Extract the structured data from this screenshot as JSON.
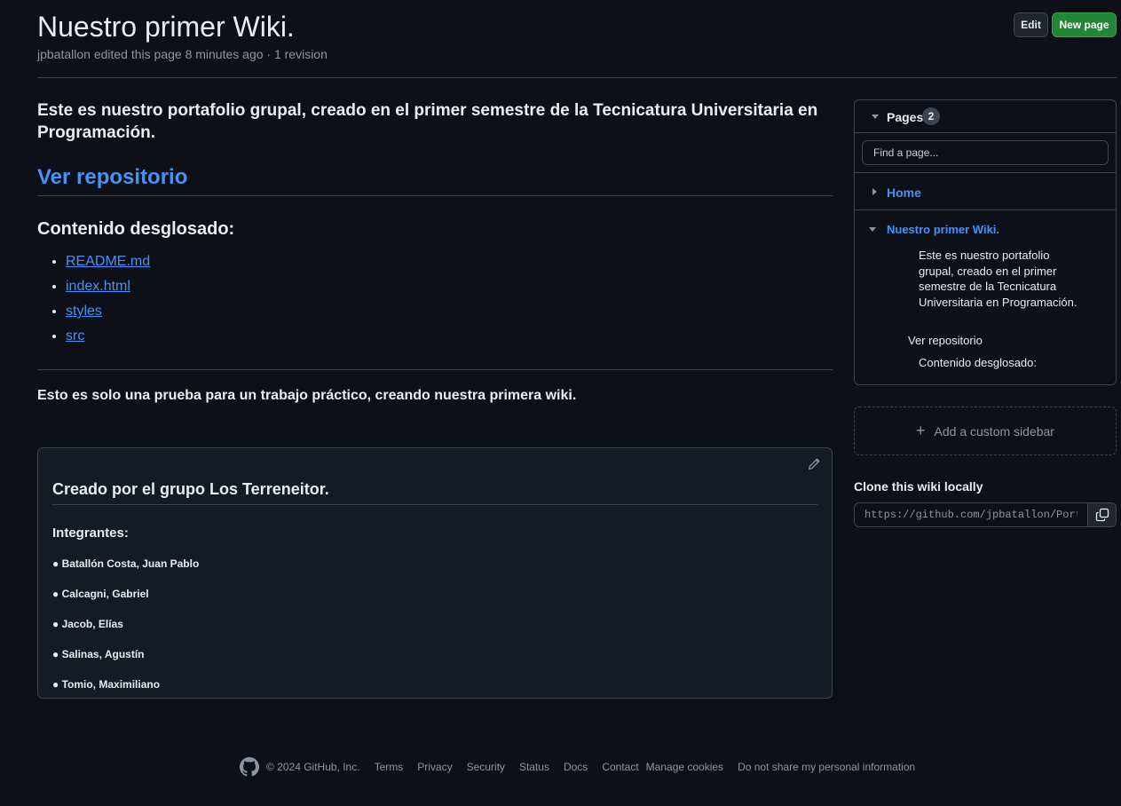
{
  "header": {
    "title": "Nuestro primer Wiki.",
    "meta": "jpbatallon edited this page 8 minutes ago · 1 revision",
    "edit_label": "Edit",
    "new_page_label": "New page"
  },
  "main": {
    "intro": "Este es nuestro portafolio grupal, creado en el primer semestre de la Tecnicatura Universitaria en Programación.",
    "repo_link": "Ver repositorio",
    "content_heading": "Contenido desglosado:",
    "files": [
      "README.md",
      "index.html",
      "styles",
      "src"
    ],
    "note": "Esto es solo una prueba para un trabajo práctico, creando nuestra primera wiki."
  },
  "footer_box": {
    "title": "Creado por el grupo Los Terreneitor.",
    "members_label": "Integrantes:",
    "members": [
      "● Batallón Costa, Juan Pablo",
      "● Calcagni, Gabriel",
      "● Jacob, Elías",
      "● Salinas, Agustín",
      "● Tomio, Maximiliano"
    ]
  },
  "sidebar": {
    "pages_label": "Pages",
    "pages_count": "2",
    "find_placeholder": "Find a page...",
    "home_label": "Home",
    "current_page_label": "Nuestro primer Wiki.",
    "toc": {
      "intro": "Este es nuestro portafolio grupal, creado en el primer semestre de la Tecnicatura Universitaria en Programación.",
      "repo": "Ver repositorio",
      "content": "Contenido desglosado:"
    },
    "add_custom_sidebar": "Add a custom sidebar",
    "clone_label": "Clone this wiki locally",
    "clone_url": "https://github.com/jpbatallon/Portfo"
  },
  "site_footer": {
    "copyright": "© 2024 GitHub, Inc.",
    "links": [
      "Terms",
      "Privacy",
      "Security",
      "Status",
      "Docs",
      "Contact",
      "Manage cookies",
      "Do not share my personal information"
    ]
  },
  "icons": {
    "pencil": "pencil-icon",
    "copy": "copy-icon",
    "github": "github-mark-icon",
    "plus": "plus-icon"
  },
  "colors": {
    "background": "#0d1117",
    "link": "#4493f8",
    "primary_button": "#238636",
    "border": "#3d444d",
    "muted": "#8d96a0"
  }
}
